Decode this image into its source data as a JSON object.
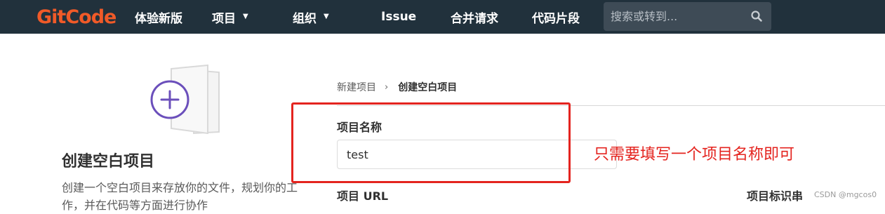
{
  "nav": {
    "logo": "GitCode",
    "items": [
      {
        "label": "体验新版",
        "dropdown": false
      },
      {
        "label": "项目",
        "dropdown": true
      },
      {
        "label": "组织",
        "dropdown": true
      },
      {
        "label": "Issue",
        "dropdown": false
      },
      {
        "label": "合并请求",
        "dropdown": false
      },
      {
        "label": "代码片段",
        "dropdown": false
      }
    ],
    "search_placeholder": "搜索或转到...",
    "icons": {
      "search": "search-icon",
      "dropdown": "chevron-down-icon"
    }
  },
  "left_panel": {
    "title": "创建空白项目",
    "description": "创建一个空白项目来存放你的文件，规划你的工作，并在代码等方面进行协作",
    "icon": "plus-document-icon"
  },
  "breadcrumb": {
    "parent": "新建项目",
    "separator": "›",
    "current": "创建空白项目"
  },
  "form": {
    "name_label": "项目名称",
    "name_value": "test",
    "url_label": "项目 URL",
    "slug_label": "项目标识串"
  },
  "annotation": {
    "note": "只需要填写一个项目名称即可"
  },
  "watermark": "CSDN @mgcos0",
  "colors": {
    "nav_bg": "#21313c",
    "logo": "#f05a28",
    "accent_purple": "#6b4fbb",
    "annotation_red": "#e4241f"
  }
}
